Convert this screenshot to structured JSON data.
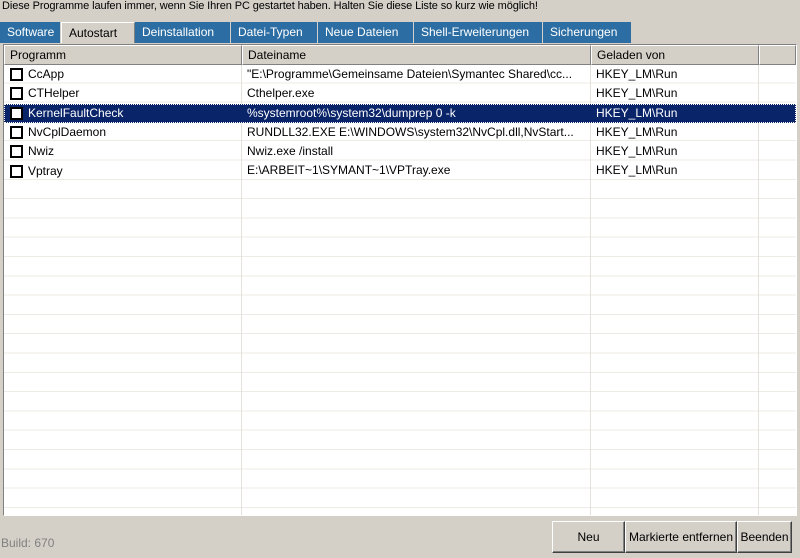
{
  "message": "Diese Programme laufen immer, wenn Sie Ihren PC gestartet haben. Halten Sie diese Liste so kurz wie möglich!",
  "tabs": [
    {
      "label": "Software"
    },
    {
      "label": "Autostart"
    },
    {
      "label": "Deinstallation"
    },
    {
      "label": "Datei-Typen"
    },
    {
      "label": "Neue Dateien"
    },
    {
      "label": "Shell-Erweiterungen"
    },
    {
      "label": "Sicherungen"
    }
  ],
  "active_tab": "Autostart",
  "columns": {
    "programm": "Programm",
    "dateiname": "Dateiname",
    "geladen_von": "Geladen von"
  },
  "rows": [
    {
      "programm": "CcApp",
      "dateiname": "\"E:\\Programme\\Gemeinsame Dateien\\Symantec Shared\\cc...",
      "geladen_von": "HKEY_LM\\Run",
      "checked": false
    },
    {
      "programm": "CTHelper",
      "dateiname": "Cthelper.exe",
      "geladen_von": "HKEY_LM\\Run",
      "checked": false
    },
    {
      "programm": "KernelFaultCheck",
      "dateiname": "%systemroot%\\system32\\dumprep 0 -k",
      "geladen_von": "HKEY_LM\\Run",
      "checked": false,
      "selected": true
    },
    {
      "programm": "NvCplDaemon",
      "dateiname": "RUNDLL32.EXE E:\\WINDOWS\\system32\\NvCpl.dll,NvStart...",
      "geladen_von": "HKEY_LM\\Run",
      "checked": false
    },
    {
      "programm": "Nwiz",
      "dateiname": "Nwiz.exe /install",
      "geladen_von": "HKEY_LM\\Run",
      "checked": false
    },
    {
      "programm": "Vptray",
      "dateiname": "E:\\ARBEIT~1\\SYMANT~1\\VPTray.exe",
      "geladen_von": "HKEY_LM\\Run",
      "checked": false
    }
  ],
  "footer": {
    "build": "Build: 670",
    "buttons": {
      "neu": "Neu",
      "markierte_entfernen": "Markierte entfernen",
      "beenden": "Beenden"
    }
  },
  "colors": {
    "tab_blue": "#2c6ea3",
    "selection": "#0a246a",
    "background": "#d4d0c8"
  }
}
